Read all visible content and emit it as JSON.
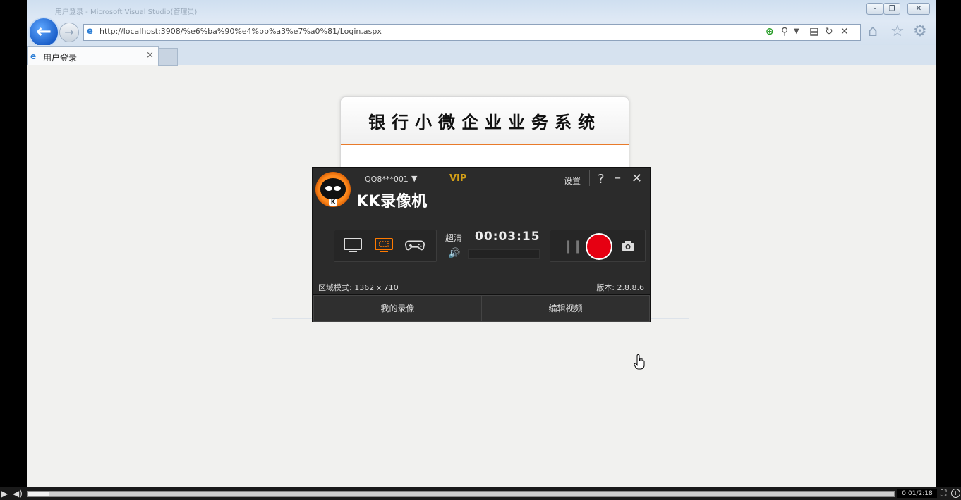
{
  "browser": {
    "title_faint": "用户登录 - Microsoft Visual Studio(管理员)",
    "url": "http://localhost:3908/%e6%ba%90%e4%bb%a3%e7%a0%81/Login.aspx",
    "tab_label": "用户登录",
    "tab_close": "×",
    "window_min": "–",
    "window_restore": "❐",
    "window_close": "✕"
  },
  "page": {
    "system_title": "银行小微企业业务系统"
  },
  "recorder": {
    "account": "QQ8***001",
    "vip": "VIP",
    "app_title": "KK录像机",
    "settings": "设置",
    "help": "?",
    "minimize": "–",
    "close": "✕",
    "quality": "超清",
    "timer": "00:03:15",
    "region": "区域模式: 1362 x 710",
    "version": "版本: 2.8.8.6",
    "my_videos": "我的录像",
    "edit_video": "编辑视频",
    "mode_selected": "region"
  },
  "player": {
    "time": "0:01/2:18",
    "progress_fraction": 0.025
  },
  "colors": {
    "accent_orange": "#ff7a00",
    "record_red": "#e60012",
    "vip_gold": "#d4a017"
  }
}
